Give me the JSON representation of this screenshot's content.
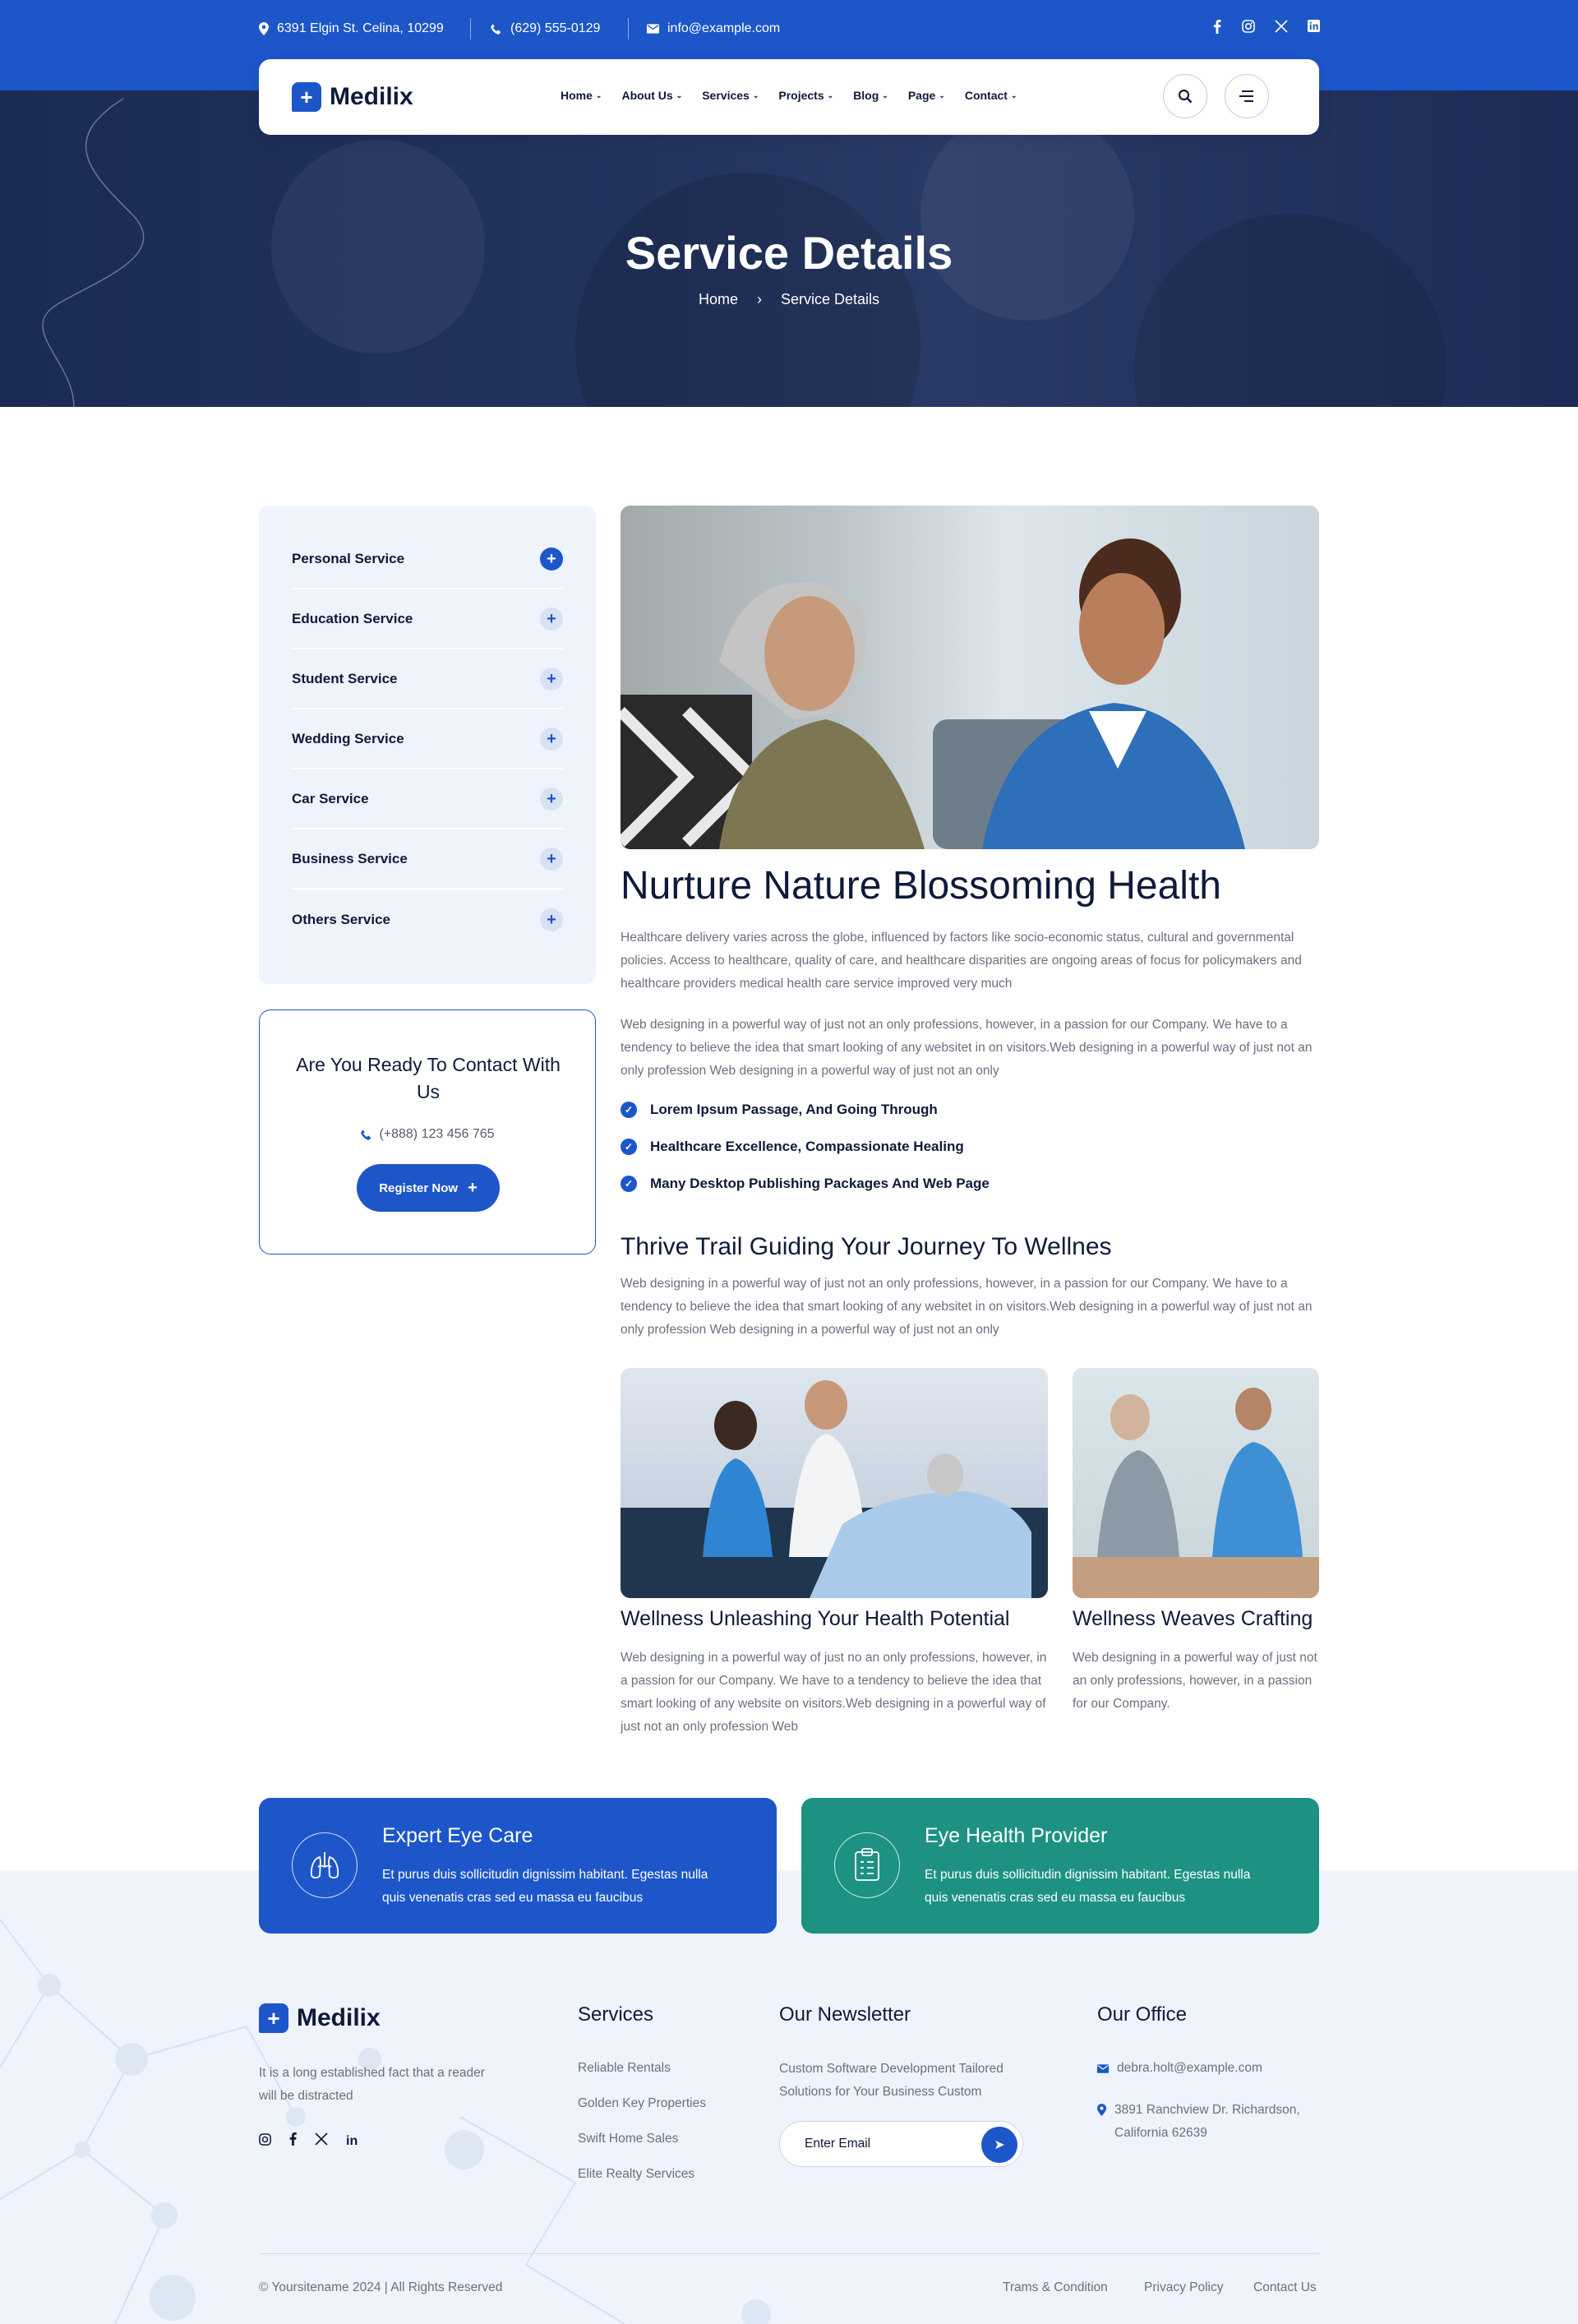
{
  "topbar": {
    "address": "6391 Elgin St. Celina, 10299",
    "phone": "(629) 555-0129",
    "email": "info@example.com",
    "socials": [
      "facebook-icon",
      "instagram-icon",
      "x-icon",
      "linkedin-icon"
    ]
  },
  "nav": {
    "logo": "Medilix",
    "menu": [
      "Home",
      "About Us",
      "Services",
      "Projects",
      "Blog",
      "Page",
      "Contact"
    ]
  },
  "hero": {
    "title": "Service Details",
    "breadcrumb": [
      "Home",
      "Service Details"
    ]
  },
  "sidebar": {
    "services": [
      "Personal Service",
      "Education Service",
      "Student Service",
      "Wedding Service",
      "Car Service",
      "Business Service",
      "Others Service"
    ],
    "contact": {
      "title": "Are You Ready To Contact With Us",
      "phone": "(+888) 123 456 765",
      "button": "Register Now"
    }
  },
  "main": {
    "title": "Nurture Nature Blossoming Health",
    "para1": "Healthcare delivery varies across the globe, influenced by factors like socio-economic status, cultural and governmental policies. Access to healthcare, quality of care, and healthcare disparities are ongoing areas of focus for policymakers and healthcare providers medical health care service improved very much",
    "para2": "Web designing in a powerful way of just not an only professions, however, in a passion for our Company. We have to a tendency to believe the idea that smart looking of any websitet in on visitors.Web designing in a powerful way of just not an only profession Web designing in a powerful way of just not an only",
    "checks": [
      "Lorem Ipsum Passage, And Going Through",
      "Healthcare Excellence, Compassionate Healing",
      "Many Desktop Publishing Packages And Web Page"
    ],
    "subtitle": "Thrive Trail Guiding Your Journey To Wellnes",
    "para3": "Web designing in a powerful way of just not an only professions, however, in a passion for our Company. We have to a tendency to believe the idea that smart looking of any websitet in on visitors.Web designing in a powerful way of just not an only profession Web designing in a powerful way of just not an only",
    "col1": {
      "title": "Wellness Unleashing Your Health Potential",
      "text": "Web designing in a powerful way of just no an only professions, however, in a passion for our Company. We have to a tendency to believe the idea that smart looking of any website on visitors.Web designing in a powerful way of just not an only profession Web"
    },
    "col2": {
      "title": "Wellness Weaves Crafting",
      "text": "Web designing in a powerful way of just not an only professions, however, in a passion for our Company."
    }
  },
  "cards": [
    {
      "title": "Expert Eye Care",
      "text": "Et purus duis sollicitudin dignissim habitant. Egestas nulla quis venenatis cras sed eu massa eu faucibus",
      "color": "#1d56c9"
    },
    {
      "title": "Eye Health Provider",
      "text": "Et purus duis sollicitudin dignissim habitant. Egestas nulla quis venenatis cras sed eu massa eu faucibus",
      "color": "#1d9283"
    }
  ],
  "footer": {
    "logo": "Medilix",
    "about": "It is a long established fact that a reader will be distracted",
    "services_title": "Services",
    "services": [
      "Reliable Rentals",
      "Golden Key Properties",
      "Swift Home Sales",
      "Elite Realty Services"
    ],
    "newsletter_title": "Our Newsletter",
    "newsletter_text": "Custom Software Development Tailored Solutions for Your Business Custom",
    "newsletter_placeholder": "Enter Email",
    "office_title": "Our Office",
    "office_email": "debra.holt@example.com",
    "office_address": "3891 Ranchview Dr. Richardson, California 62639",
    "copyright": "© Yoursitename  2024 | All Rights Reserved",
    "links": [
      "Trams & Condition",
      "Privacy Policy",
      "Contact Us"
    ]
  }
}
